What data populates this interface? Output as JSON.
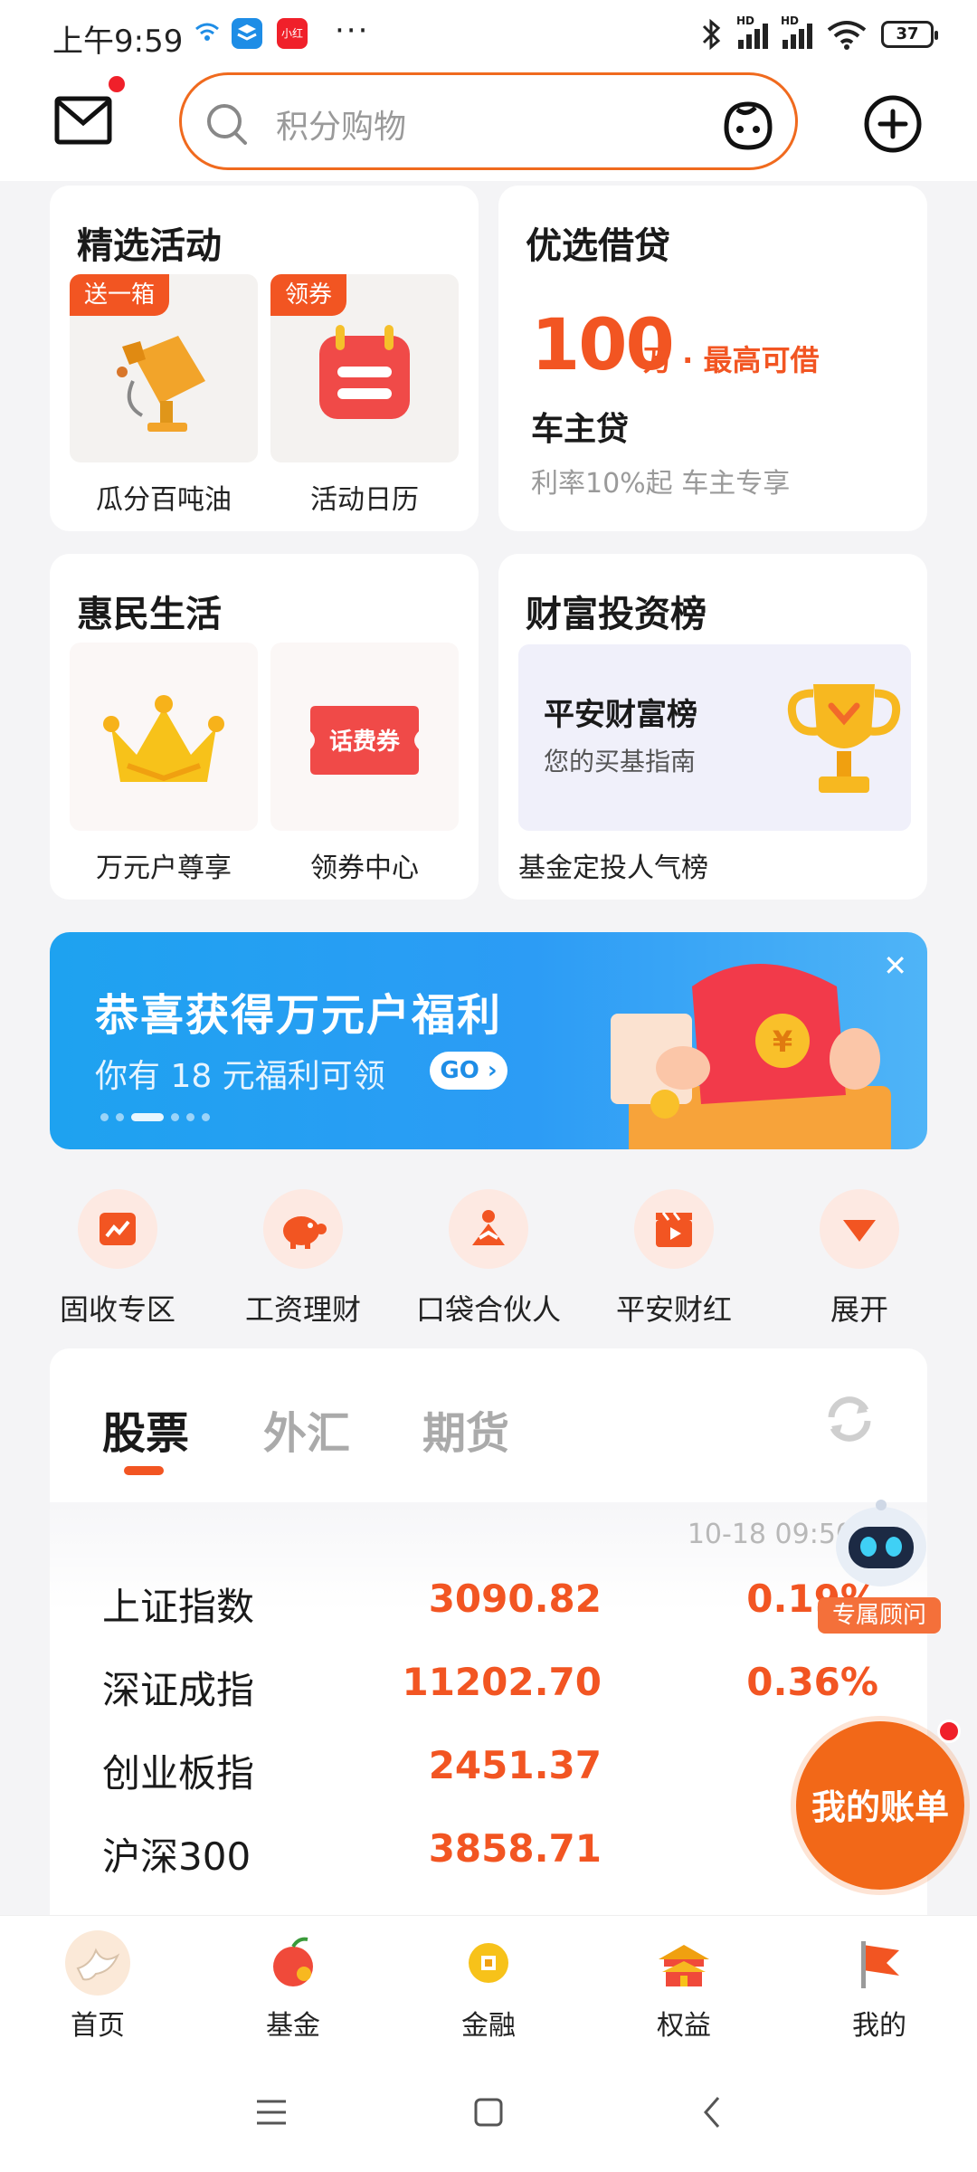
{
  "status_bar": {
    "time": "上午9:59",
    "battery": "37",
    "app1": "小红书"
  },
  "header": {
    "search_placeholder": "积分购物"
  },
  "cards": {
    "activities": {
      "title": "精选活动",
      "items": [
        {
          "badge": "送一箱",
          "label": "瓜分百吨油"
        },
        {
          "badge": "领券",
          "label": "活动日历"
        }
      ]
    },
    "loan": {
      "title": "优选借贷",
      "amount": "100",
      "amount_sub": "万 · 最高可借",
      "product": "车主贷",
      "desc": "利率10%起 车主专享"
    },
    "life": {
      "title": "惠民生活",
      "items": [
        {
          "label": "万元户尊享"
        },
        {
          "label": "领券中心",
          "coupon_text": "话费券"
        }
      ]
    },
    "wealth": {
      "title": "财富投资榜",
      "box_title": "平安财富榜",
      "box_sub": "您的买基指南",
      "label": "基金定投人气榜"
    }
  },
  "banner": {
    "title": "恭喜获得万元户福利",
    "sub": "你有 18 元福利可领",
    "go": "GO ›",
    "close": "✕"
  },
  "quick_actions": [
    {
      "label": "固收专区"
    },
    {
      "label": "工资理财"
    },
    {
      "label": "口袋合伙人"
    },
    {
      "label": "平安财红"
    },
    {
      "label": "展开"
    }
  ],
  "market": {
    "tabs": [
      {
        "label": "股票"
      },
      {
        "label": "外汇"
      },
      {
        "label": "期货"
      }
    ],
    "time": "10-18 09:50",
    "rows": [
      {
        "name": "上证指数",
        "value": "3090.82",
        "pct": "0.19%"
      },
      {
        "name": "深证成指",
        "value": "11202.70",
        "pct": "0.36%"
      },
      {
        "name": "创业板指",
        "value": "2451.37",
        "pct": "0."
      },
      {
        "name": "沪深300",
        "value": "3858.71",
        "pct": "0."
      }
    ]
  },
  "floating": {
    "advisor": "专属顾问",
    "bill": "我的账单"
  },
  "nav": [
    {
      "label": "首页"
    },
    {
      "label": "基金"
    },
    {
      "label": "金融"
    },
    {
      "label": "权益"
    },
    {
      "label": "我的"
    }
  ],
  "colors": {
    "accent": "#f25522",
    "banner": "#1ea2f0"
  }
}
